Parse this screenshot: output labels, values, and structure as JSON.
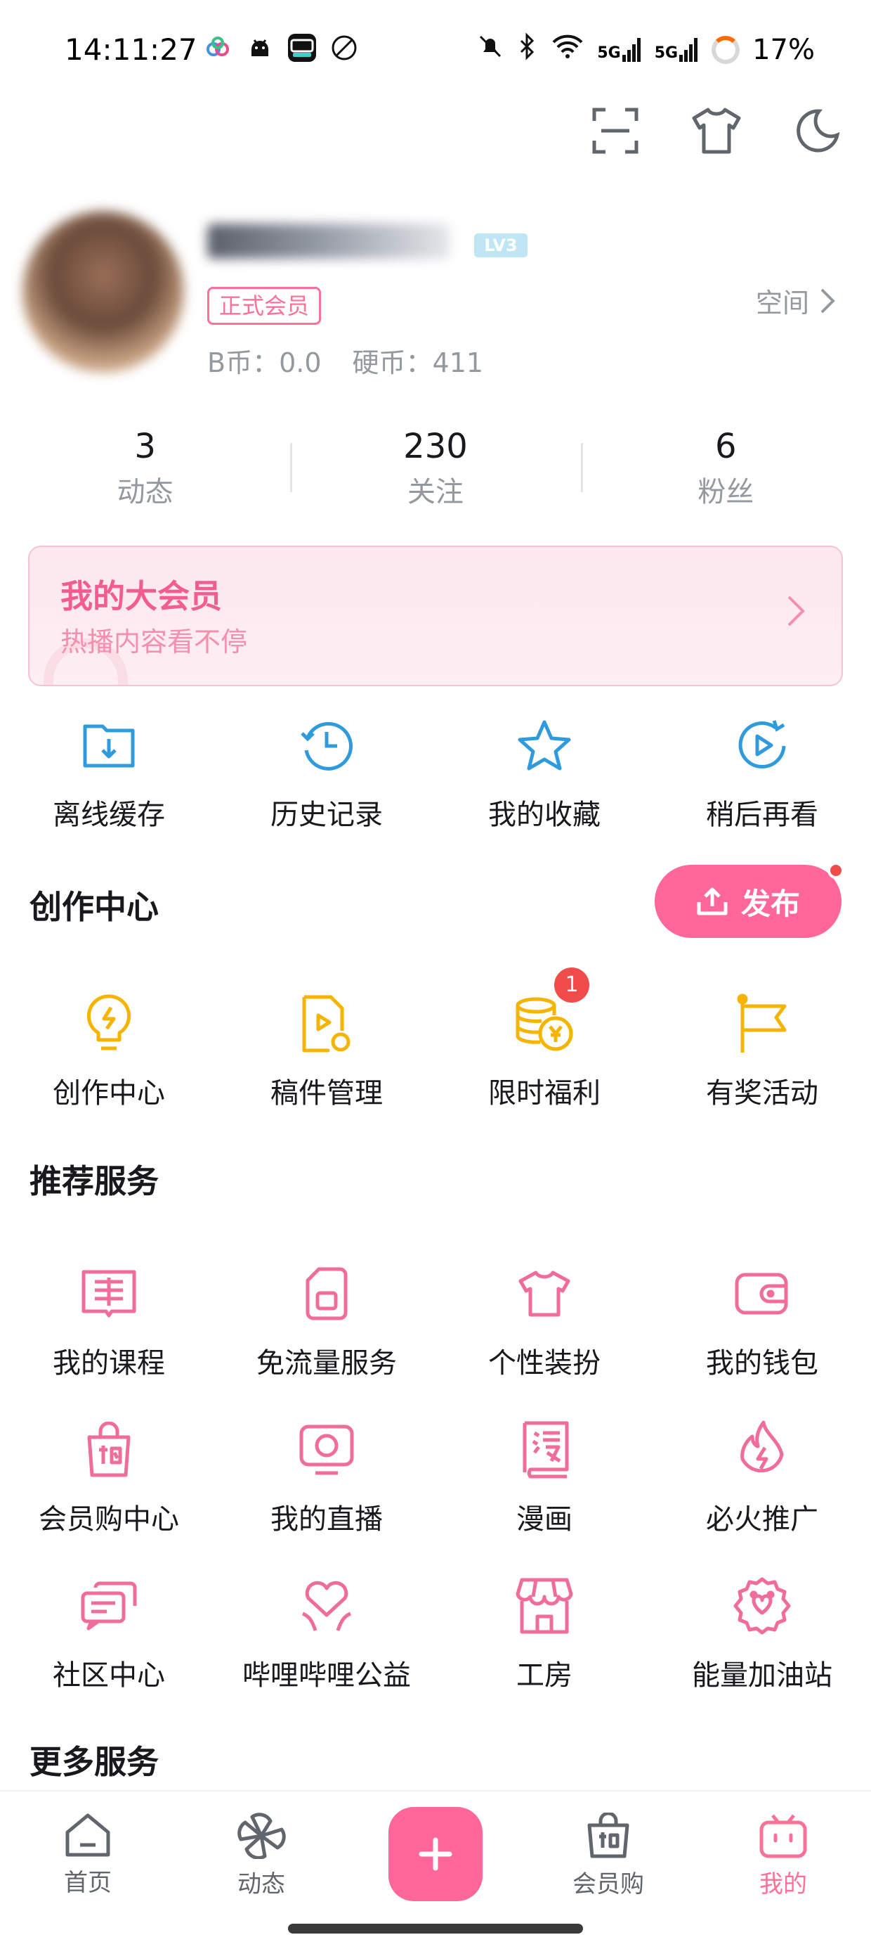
{
  "status_bar": {
    "time": "14:11:27",
    "apps": [
      "app-icon-cloud",
      "app-icon-android",
      "app-icon-dewu",
      "app-icon-no-disturb"
    ],
    "signal_1": "5G",
    "signal_2": "5G",
    "battery": "17%"
  },
  "top_actions": {
    "icons": [
      "scan-icon",
      "shirt-icon",
      "night-mode-icon"
    ]
  },
  "profile": {
    "level_badge": "LV3",
    "member_badge": "正式会员",
    "space_link": "空间",
    "b_coin": "B币：0.0",
    "hard_coin": "硬币：411"
  },
  "stats": [
    {
      "value": "3",
      "label": "动态"
    },
    {
      "value": "230",
      "label": "关注"
    },
    {
      "value": "6",
      "label": "粉丝"
    }
  ],
  "vip_banner": {
    "title": "我的大会员",
    "subtitle": "热播内容看不停"
  },
  "quick_actions": [
    {
      "label": "离线缓存",
      "icon": "download-folder-icon"
    },
    {
      "label": "历史记录",
      "icon": "history-clock-icon"
    },
    {
      "label": "我的收藏",
      "icon": "star-icon"
    },
    {
      "label": "稍后再看",
      "icon": "watch-later-icon"
    }
  ],
  "creator_section": {
    "title": "创作中心",
    "publish_label": "发布",
    "items": [
      {
        "label": "创作中心",
        "icon": "lightbulb-icon"
      },
      {
        "label": "稿件管理",
        "icon": "manuscript-icon"
      },
      {
        "label": "限时福利",
        "icon": "coins-icon",
        "badge": "1"
      },
      {
        "label": "有奖活动",
        "icon": "flag-icon"
      }
    ]
  },
  "services_section": {
    "title": "推荐服务",
    "items": [
      {
        "label": "我的课程",
        "icon": "course-book-icon"
      },
      {
        "label": "免流量服务",
        "icon": "sim-card-icon"
      },
      {
        "label": "个性装扮",
        "icon": "shirt-icon"
      },
      {
        "label": "我的钱包",
        "icon": "wallet-icon"
      },
      {
        "label": "会员购中心",
        "icon": "shopping-bag-icon"
      },
      {
        "label": "我的直播",
        "icon": "live-tv-icon"
      },
      {
        "label": "漫画",
        "icon": "manga-book-icon"
      },
      {
        "label": "必火推广",
        "icon": "fire-icon"
      },
      {
        "label": "社区中心",
        "icon": "chat-bubbles-icon"
      },
      {
        "label": "哔哩哔哩公益",
        "icon": "heart-hands-icon"
      },
      {
        "label": "工房",
        "icon": "storefront-icon"
      },
      {
        "label": "能量加油站",
        "icon": "energy-badge-icon"
      }
    ]
  },
  "more_section": {
    "title": "更多服务"
  },
  "bottom_nav": [
    {
      "label": "首页",
      "icon": "home-icon"
    },
    {
      "label": "动态",
      "icon": "pinwheel-icon"
    },
    {
      "label": "",
      "icon": "plus-icon"
    },
    {
      "label": "会员购",
      "icon": "shopping-bag-icon"
    },
    {
      "label": "我的",
      "icon": "tv-icon"
    }
  ],
  "colors": {
    "brand_pink": "#fb7299",
    "publish_pink": "#ff6699",
    "blue_icons": "#2f9bdc",
    "yellow_icons": "#f5b400",
    "badge_red": "#f04c49"
  }
}
